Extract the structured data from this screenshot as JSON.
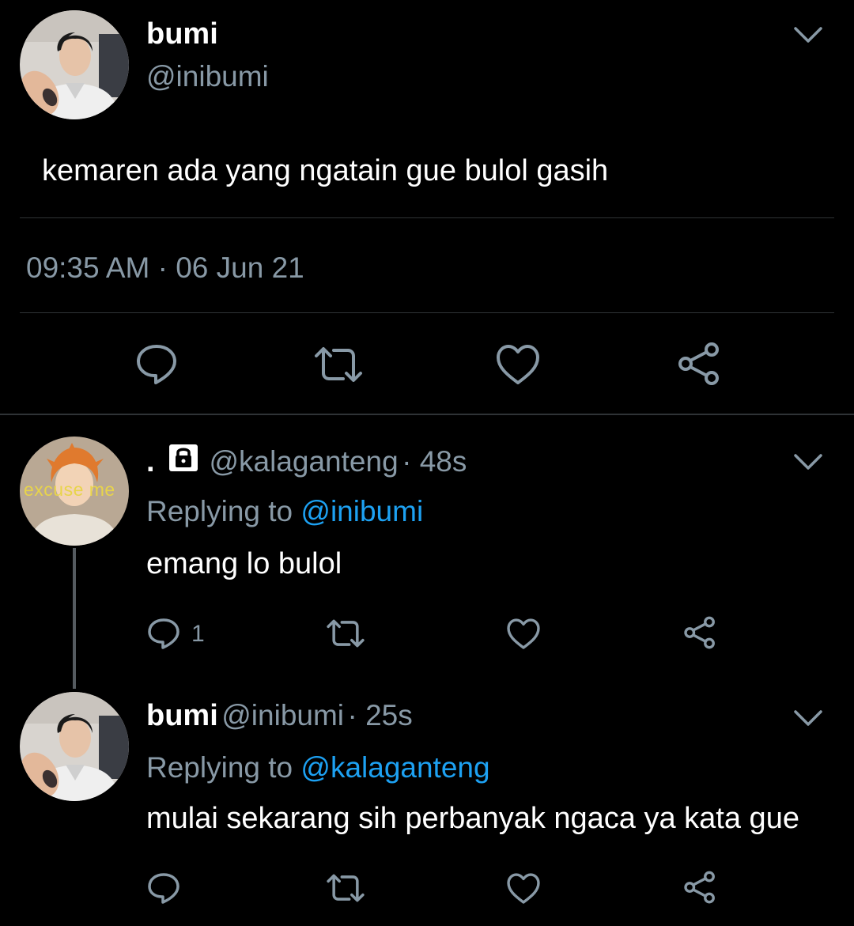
{
  "main_tweet": {
    "name": "bumi",
    "handle": "@inibumi",
    "text": "kemaren ada yang ngatain gue bulol gasih",
    "timestamp": "09:35 AM · 06 Jun 21",
    "avatar_icon": "profile-photo-person"
  },
  "replies": [
    {
      "name": ".",
      "lock_icon": "lock-icon",
      "handle": "@kalaganteng",
      "time": "· 48s",
      "replying_prefix": "Replying to ",
      "replying_to": "@inibumi",
      "text": "emang lo bulol",
      "reply_count": "1",
      "avatar_text": "excuse me"
    },
    {
      "name": "bumi",
      "handle": "@inibumi",
      "time": "· 25s",
      "replying_prefix": "Replying to ",
      "replying_to": "@kalaganteng",
      "text": "mulai sekarang sih perbanyak ngaca ya kata gue",
      "reply_count": ""
    }
  ],
  "colors": {
    "background": "#000000",
    "text": "#ffffff",
    "secondary": "#8899a6",
    "link": "#1da1f2",
    "divider": "#2f3336"
  }
}
